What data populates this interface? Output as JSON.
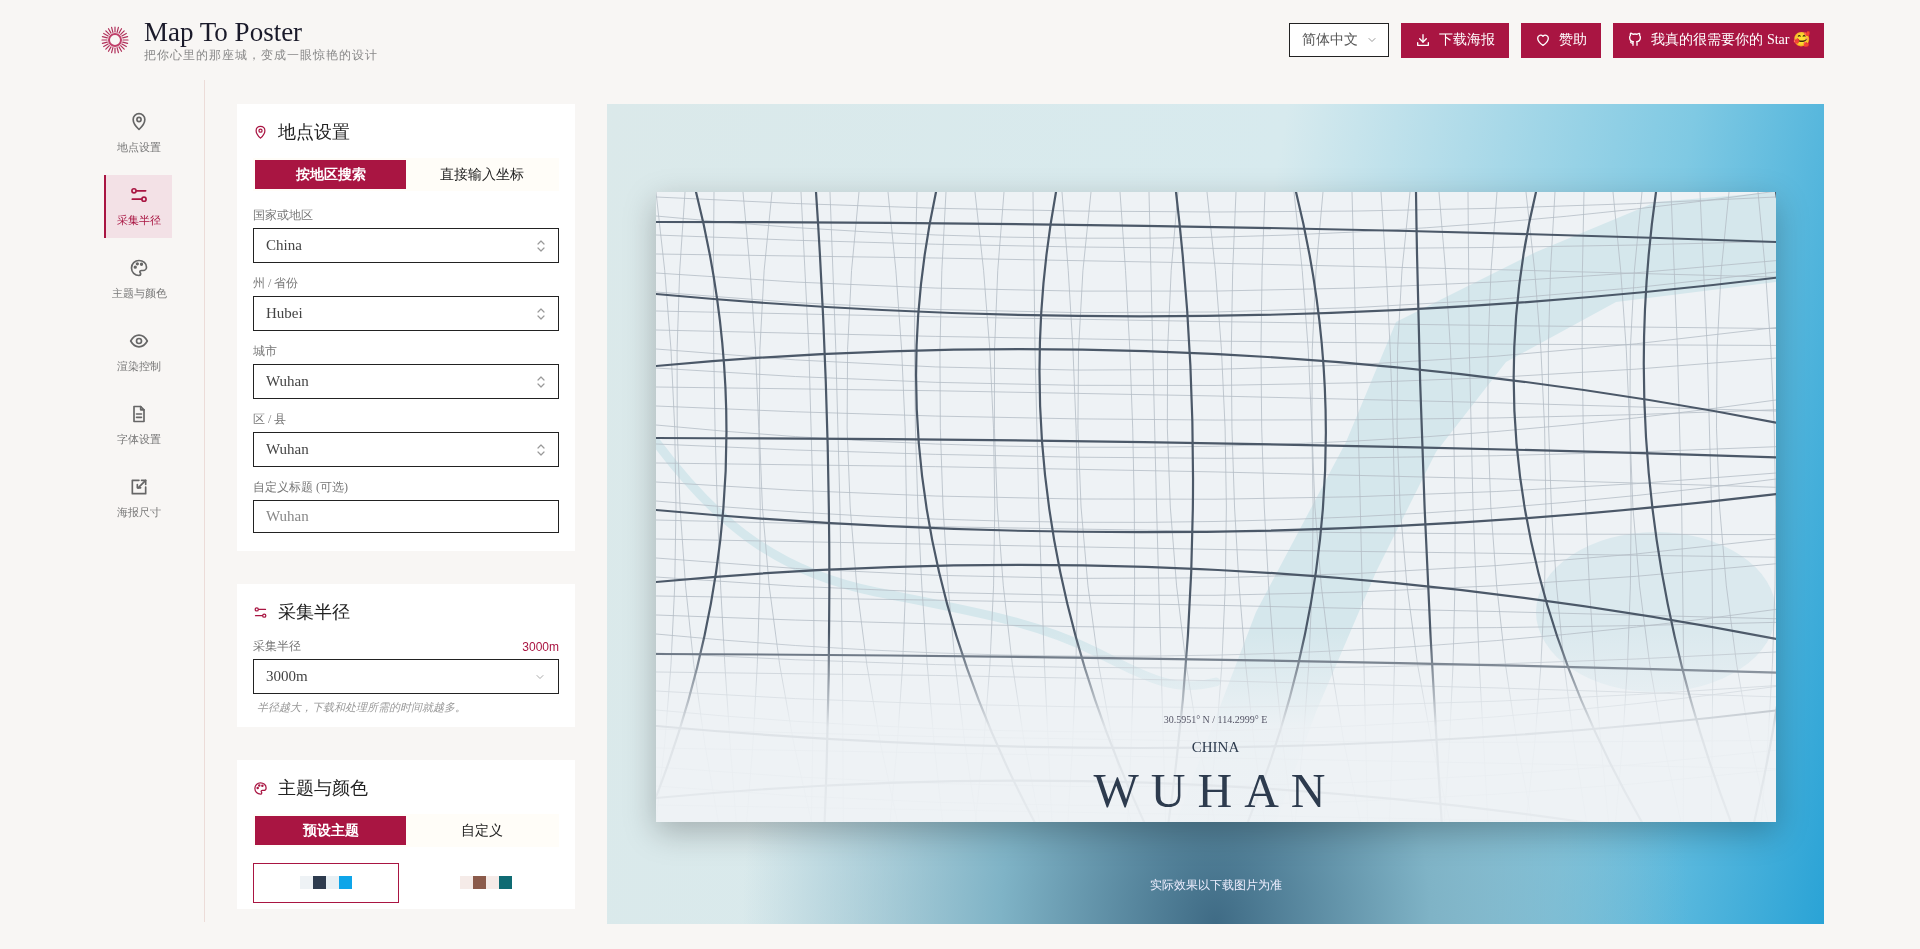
{
  "header": {
    "title": "Map To Poster",
    "subtitle": "把你心里的那座城，变成一眼惊艳的设计",
    "language": "简体中文",
    "buttons": [
      {
        "kind": "download",
        "label": "下载海报"
      },
      {
        "kind": "sponsor",
        "label": "赞助"
      },
      {
        "kind": "github",
        "label": "我真的很需要你的 Star 🥰"
      }
    ]
  },
  "sidebar": {
    "items": [
      {
        "kind": "pin",
        "label": "地点设置",
        "selected": false
      },
      {
        "kind": "sliders",
        "label": "采集半径",
        "selected": true
      },
      {
        "kind": "palette",
        "label": "主题与颜色",
        "selected": false
      },
      {
        "kind": "eye",
        "label": "渲染控制",
        "selected": false
      },
      {
        "kind": "file",
        "label": "字体设置",
        "selected": false
      },
      {
        "kind": "resize",
        "label": "海报尺寸",
        "selected": false
      }
    ]
  },
  "location": {
    "title": "地点设置",
    "tabs": [
      {
        "label": "按地区搜索",
        "selected": true
      },
      {
        "label": "直接输入坐标",
        "selected": false
      }
    ],
    "fields": [
      {
        "kind": "select",
        "label": "国家或地区",
        "value": "China"
      },
      {
        "kind": "select",
        "label": "州 / 省份",
        "value": "Hubei"
      },
      {
        "kind": "select",
        "label": "城市",
        "value": "Wuhan"
      },
      {
        "kind": "select",
        "label": "区 / 县",
        "value": "Wuhan"
      },
      {
        "kind": "input",
        "label": "自定义标题 (可选)",
        "placeholder": "Wuhan"
      }
    ]
  },
  "radius": {
    "title": "采集半径",
    "label": "采集半径",
    "reading": "3000m",
    "value": "3000m",
    "hint": "半径越大，下载和处理所需的时间就越多。"
  },
  "theme": {
    "title": "主题与颜色",
    "tabs": [
      {
        "label": "预设主题",
        "selected": true
      },
      {
        "label": "自定义",
        "selected": false
      }
    ],
    "presets": [
      {
        "selected": true,
        "swatches": [
          {
            "color": "#eef2f5"
          },
          {
            "color": "#2d3b4e"
          },
          {
            "color": "#e8f0f4"
          },
          {
            "color": "#0ea5e9"
          }
        ]
      },
      {
        "selected": false,
        "swatches": [
          {
            "color": "#f5ebe8"
          },
          {
            "color": "#8b5a4a"
          },
          {
            "color": "#f5ebe8"
          },
          {
            "color": "#0f6b73"
          }
        ]
      }
    ]
  },
  "preview": {
    "poster": {
      "coordinates": "30.5951° N / 114.2999° E",
      "country": "CHINA",
      "city": "WUHAN"
    },
    "note": "实际效果以下载图片为准"
  }
}
